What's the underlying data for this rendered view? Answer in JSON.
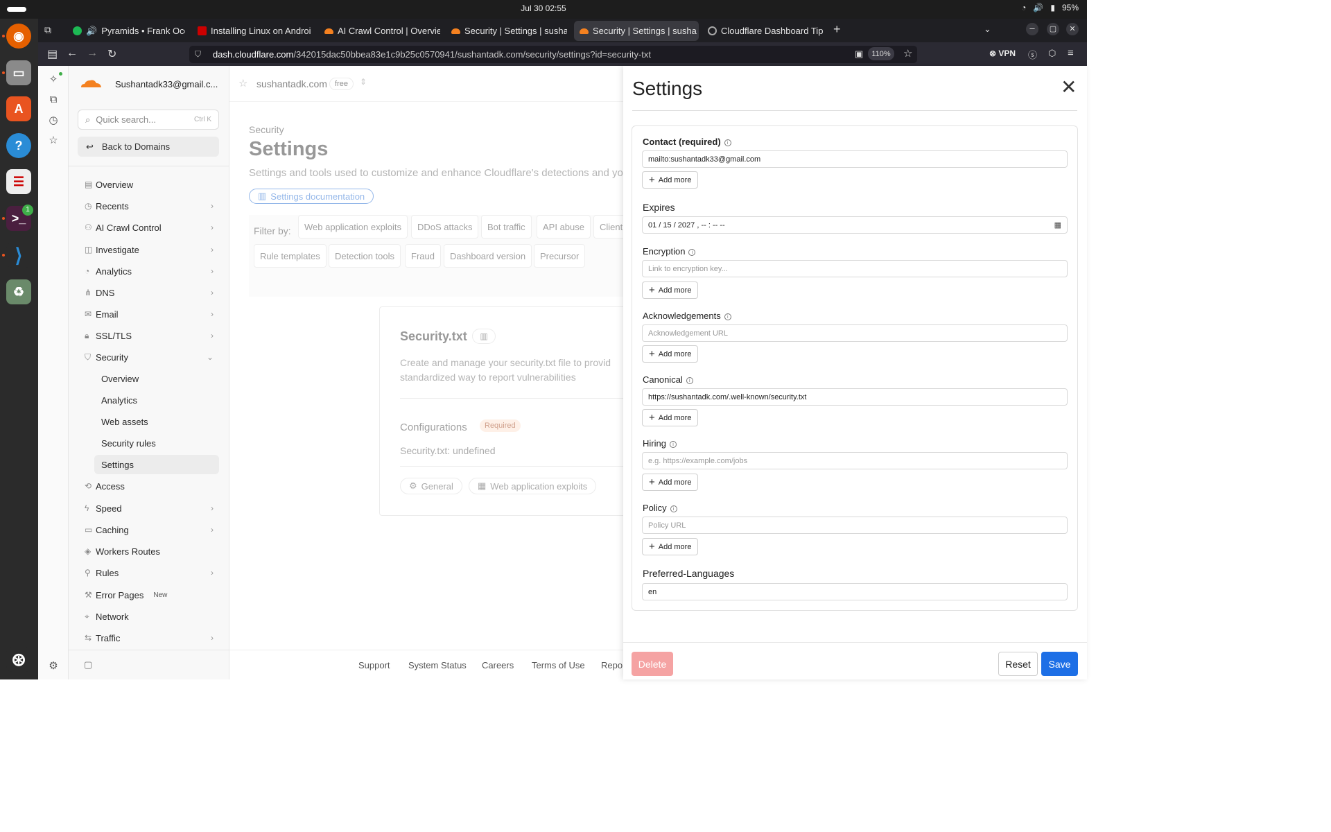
{
  "system": {
    "clock": "Jul 30  02:55",
    "battery": "95%"
  },
  "browser": {
    "tabs": [
      {
        "label": "Pyramids • Frank Ocea",
        "color": "#1db954",
        "audio": "🔊"
      },
      {
        "label": "Installing Linux on Androi",
        "color": "#cc0000"
      },
      {
        "label": "AI Crawl Control | Overvie",
        "color": "#f48120"
      },
      {
        "label": "Security | Settings | susha",
        "color": "#f48120"
      },
      {
        "label": "Security | Settings | susha",
        "color": "#f48120"
      },
      {
        "label": "Cloudflare Dashboard Tip",
        "color": "#888888"
      }
    ],
    "url_host": "dash.cloudflare.com",
    "url_path": "/342015dac50bbea83e1c9b25c0570941/sushantadk.com/security/settings?id=security-txt",
    "zoom": "110%",
    "vpn": "VPN"
  },
  "dock": {
    "terminal_badge": "1"
  },
  "sidebar": {
    "account": "Sushantadk33@gmail.c...",
    "search_placeholder": "Quick search...",
    "search_shortcut": "Ctrl K",
    "back": "Back to Domains",
    "items": [
      {
        "label": "Overview",
        "chev": ""
      },
      {
        "label": "Recents",
        "chev": "›"
      },
      {
        "label": "AI Crawl Control",
        "chev": "›"
      },
      {
        "label": "Investigate",
        "chev": "›"
      },
      {
        "label": "Analytics",
        "chev": "›"
      },
      {
        "label": "DNS",
        "chev": "›"
      },
      {
        "label": "Email",
        "chev": "›"
      },
      {
        "label": "SSL/TLS",
        "chev": "›"
      },
      {
        "label": "Security",
        "chev": "⌄"
      }
    ],
    "security_sub": [
      "Overview",
      "Analytics",
      "Web assets",
      "Security rules",
      "Settings"
    ],
    "items2": [
      {
        "label": "Access",
        "chev": ""
      },
      {
        "label": "Speed",
        "chev": "›"
      },
      {
        "label": "Caching",
        "chev": "›"
      },
      {
        "label": "Workers Routes",
        "chev": ""
      },
      {
        "label": "Rules",
        "chev": "›"
      },
      {
        "label": "Error Pages",
        "chev": ""
      },
      {
        "label": "Network",
        "chev": ""
      },
      {
        "label": "Traffic",
        "chev": "›"
      }
    ],
    "new_badge": "New"
  },
  "main": {
    "domain": "sushantadk.com",
    "plan": "free",
    "breadcrumb": "Security",
    "title": "Settings",
    "description": "Settings and tools used to customize and enhance Cloudflare's detections and you",
    "doc_button": "Settings documentation",
    "filter_label": "Filter by:",
    "filters_row1": [
      "Web application exploits",
      "DDoS attacks",
      "Bot traffic",
      "API abuse",
      "Client"
    ],
    "filters_row2": [
      "Rule templates",
      "Detection tools",
      "Fraud",
      "Dashboard version",
      "Precursor"
    ],
    "card": {
      "title": "Security.txt",
      "description": "Create and manage your security.txt file to provid standardized way to report vulnerabilities",
      "config_label": "Configurations",
      "required": "Required",
      "value": "Security.txt: undefined",
      "chips": [
        "General",
        "Web application exploits"
      ]
    },
    "footer": [
      "Support",
      "System Status",
      "Careers",
      "Terms of Use",
      "Repor"
    ]
  },
  "panel": {
    "title": "Settings",
    "add_more": "Add more",
    "contact": {
      "label": "Contact (required)",
      "value": "mailto:sushantadk33@gmail.com"
    },
    "expires": {
      "label": "Expires",
      "value": "01 / 15 / 2027 ,  -- : --   --"
    },
    "encryption": {
      "label": "Encryption",
      "placeholder": "Link to encryption key..."
    },
    "acknowledgements": {
      "label": "Acknowledgements",
      "placeholder": "Acknowledgement URL"
    },
    "canonical": {
      "label": "Canonical",
      "value": "https://sushantadk.com/.well-known/security.txt"
    },
    "hiring": {
      "label": "Hiring",
      "placeholder": "e.g. https://example.com/jobs"
    },
    "policy": {
      "label": "Policy",
      "placeholder": "Policy URL"
    },
    "languages": {
      "label": "Preferred-Languages",
      "value": "en"
    },
    "delete": "Delete",
    "reset": "Reset",
    "save": "Save"
  }
}
